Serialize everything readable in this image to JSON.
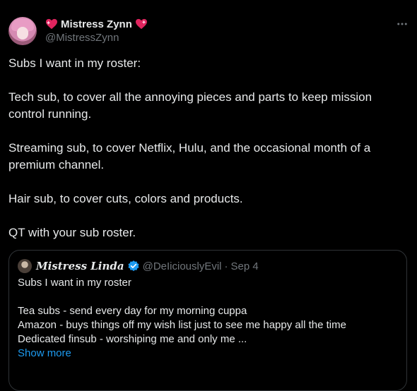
{
  "author": {
    "name": "Mistress Zynn",
    "handle": "@MistressZynn"
  },
  "tweet": {
    "paragraphs": [
      "Subs I want in my roster:",
      "Tech sub, to cover all the annoying pieces and parts to keep mission control running.",
      "Streaming sub, to cover Netflix, Hulu, and the occasional month of a premium channel.",
      "Hair sub, to cover cuts, colors and products.",
      "QT with your sub roster."
    ]
  },
  "quote": {
    "name": "Mistress Linda",
    "handle": "@DeIiciouslyEvil",
    "separator": "·",
    "date": "Sep 4",
    "lines": {
      "first": "Subs I want in my roster",
      "second": "Tea subs - send every day for my morning cuppa",
      "third": "Amazon - buys things off my wish list just to see me happy all the time",
      "fourth": "Dedicated finsub - worshiping me and only me ..."
    },
    "show_more": "Show more"
  },
  "icons": {
    "heart": "sparkling-heart-icon",
    "more": "more-horizontal-icon",
    "verified": "verified-badge-icon"
  },
  "colors": {
    "background": "#000000",
    "text": "#e7e9ea",
    "secondary": "#71767b",
    "accent": "#1d9bf0",
    "border": "#2f3336"
  }
}
